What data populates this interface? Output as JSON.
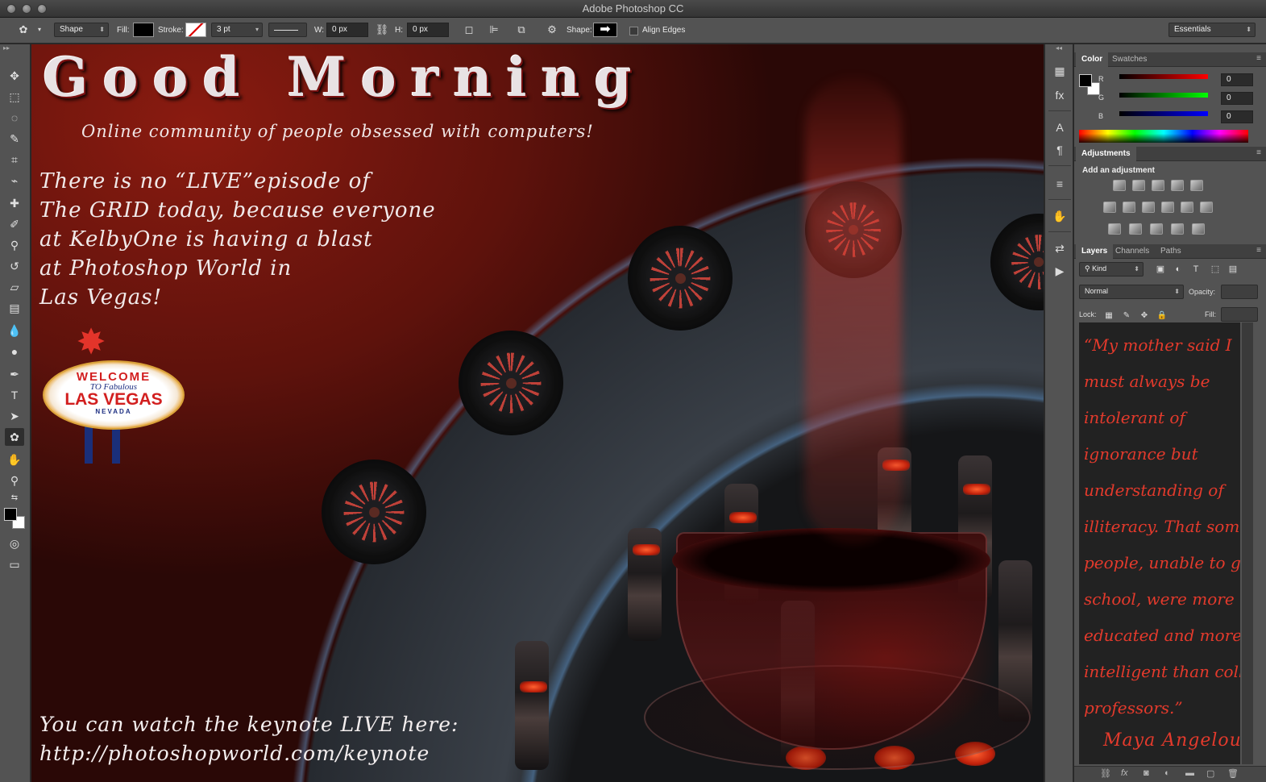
{
  "window": {
    "title": "Adobe Photoshop CC"
  },
  "options": {
    "tool_mode": "Shape",
    "fill_label": "Fill:",
    "stroke_label": "Stroke:",
    "stroke_width": "3 pt",
    "w_label": "W:",
    "w_value": "0 px",
    "h_label": "H:",
    "h_value": "0 px",
    "shape_label": "Shape:",
    "align_edges": "Align Edges",
    "workspace": "Essentials"
  },
  "canvas": {
    "title": "Good Morning",
    "subtitle": "Online community of people obsessed with computers!",
    "message_lines": [
      "There is no “LIVE”episode of",
      "The GRID today, because everyone",
      "at KelbyOne is having a blast",
      "at Photoshop World in",
      "Las Vegas!"
    ],
    "sign": {
      "welcome": "WELCOME",
      "to": "TO Fabulous",
      "city": "LAS VEGAS",
      "state": "NEVADA"
    },
    "footer_lines": [
      "You can watch the keynote LIVE here:",
      "http://photoshopworld.com/keynote"
    ]
  },
  "color_panel": {
    "tabs": [
      "Color",
      "Swatches"
    ],
    "r_label": "R",
    "r_value": "0",
    "g_label": "G",
    "g_value": "0",
    "b_label": "B",
    "b_value": "0"
  },
  "adjustments_panel": {
    "tab": "Adjustments",
    "heading": "Add an adjustment"
  },
  "layers_panel": {
    "tabs": [
      "Layers",
      "Channels",
      "Paths"
    ],
    "filter": "Kind",
    "blend_mode": "Normal",
    "opacity_label": "Opacity:",
    "lock_label": "Lock:",
    "fill_label": "Fill:",
    "quote_lines": [
      "“My mother said I",
      "must always be",
      "intolerant of",
      "ignorance but",
      "understanding of",
      "illiteracy. That some",
      "people, unable to go to",
      "school, were more",
      "educated and more",
      "intelligent than college",
      "professors.”"
    ],
    "quote_author": "Maya Angelou"
  },
  "colors": {
    "accent_red": "#e33a2c",
    "ui_gray": "#535353",
    "ui_dark": "#282828"
  }
}
